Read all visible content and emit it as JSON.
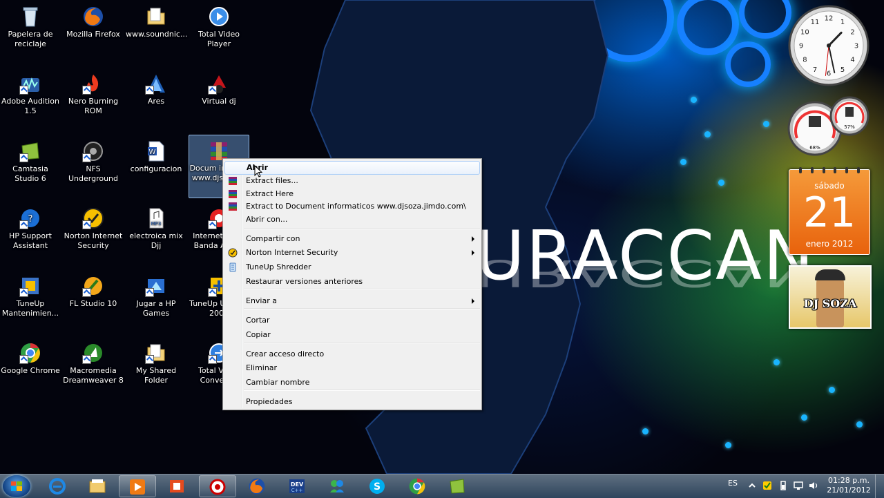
{
  "wallpaper": {
    "text": "URACCAN"
  },
  "desktop_icons": [
    {
      "label": "Papelera de reciclaje",
      "icon": "recycle-bin-icon"
    },
    {
      "label": "Mozilla Firefox",
      "icon": "firefox-icon"
    },
    {
      "label": "www.soundnic...",
      "icon": "folder-icon"
    },
    {
      "label": "Total Video Player",
      "icon": "video-player-icon"
    },
    {
      "label": "Adobe Audition 1.5",
      "icon": "audition-icon"
    },
    {
      "label": "Nero Burning ROM",
      "icon": "nero-icon"
    },
    {
      "label": "Ares",
      "icon": "ares-icon"
    },
    {
      "label": "Virtual dj",
      "icon": "virtual-dj-icon"
    },
    {
      "label": "Camtasia Studio 6",
      "icon": "camtasia-icon"
    },
    {
      "label": "NFS Underground",
      "icon": "nfs-icon"
    },
    {
      "label": "configuracion",
      "icon": "word-document-icon"
    },
    {
      "label": "Docum informa www.djso o.co",
      "icon": "winrar-archive-icon"
    },
    {
      "label": "HP Support Assistant",
      "icon": "hp-support-icon"
    },
    {
      "label": "Norton Internet Security",
      "icon": "norton-icon"
    },
    {
      "label": "electroica mix Djj",
      "icon": "mp3-file-icon"
    },
    {
      "label": "Internet Claro Banda Ancha",
      "icon": "claro-icon"
    },
    {
      "label": "TuneUp Mantenimien...",
      "icon": "tuneup-icon"
    },
    {
      "label": "FL Studio 10",
      "icon": "fl-studio-icon"
    },
    {
      "label": "Jugar a HP Games",
      "icon": "hp-games-icon"
    },
    {
      "label": "TuneUp Utilities 2009",
      "icon": "tuneup-utilities-icon"
    },
    {
      "label": "Google Chrome",
      "icon": "chrome-icon"
    },
    {
      "label": "Macromedia Dreamweaver 8",
      "icon": "dreamweaver-icon"
    },
    {
      "label": "My Shared Folder",
      "icon": "folder-icon"
    },
    {
      "label": "Total Video Converter",
      "icon": "video-converter-icon"
    }
  ],
  "context_menu": {
    "items": [
      {
        "label": "Abrir",
        "bold": true,
        "hover": true
      },
      {
        "label": "Extract files...",
        "icon": "winrar-icon"
      },
      {
        "label": "Extract Here",
        "icon": "winrar-icon"
      },
      {
        "label": "Extract to Document informaticos www.djsoza.jimdo.com\\",
        "icon": "winrar-icon"
      },
      {
        "label": "Abrir con..."
      },
      {
        "label": "Compartir con",
        "submenu": true
      },
      {
        "label": "Norton Internet Security",
        "icon": "norton-icon",
        "submenu": true
      },
      {
        "label": "TuneUp Shredder",
        "icon": "shredder-icon"
      },
      {
        "label": "Restaurar versiones anteriores"
      },
      {
        "label": "Enviar a",
        "submenu": true
      },
      {
        "label": "Cortar"
      },
      {
        "label": "Copiar"
      },
      {
        "label": "Crear acceso directo"
      },
      {
        "label": "Eliminar"
      },
      {
        "label": "Cambiar nombre"
      },
      {
        "label": "Propiedades"
      }
    ]
  },
  "gadgets": {
    "clock": {
      "hour": 1,
      "minute": 28,
      "second": 31
    },
    "meter": {
      "cpu_percent": "68%",
      "memory_percent": "57%"
    },
    "calendar": {
      "weekday": "sábado",
      "day": "21",
      "month_year": "enero 2012"
    },
    "photo": {
      "label": "DJ SOZA"
    }
  },
  "taskbar": {
    "pinned": [
      {
        "icon": "internet-explorer-icon"
      },
      {
        "icon": "windows-explorer-icon"
      },
      {
        "icon": "media-player-icon"
      },
      {
        "icon": "office-icon"
      },
      {
        "icon": "camtasia-recorder-icon"
      },
      {
        "icon": "firefox-icon"
      },
      {
        "icon": "dev-cpp-icon",
        "text": "DEV"
      },
      {
        "icon": "messenger-icon"
      },
      {
        "icon": "skype-icon"
      },
      {
        "icon": "chrome-icon"
      },
      {
        "icon": "camtasia-studio-icon"
      }
    ],
    "language": "ES",
    "time": "01:28 p.m.",
    "date": "21/01/2012"
  },
  "colors": {
    "wallpaper_blue": "#1680ff",
    "calendar_orange": "#e8620c",
    "menu_background": "#f0f0f0",
    "menu_hover_border": "#aecff7"
  }
}
